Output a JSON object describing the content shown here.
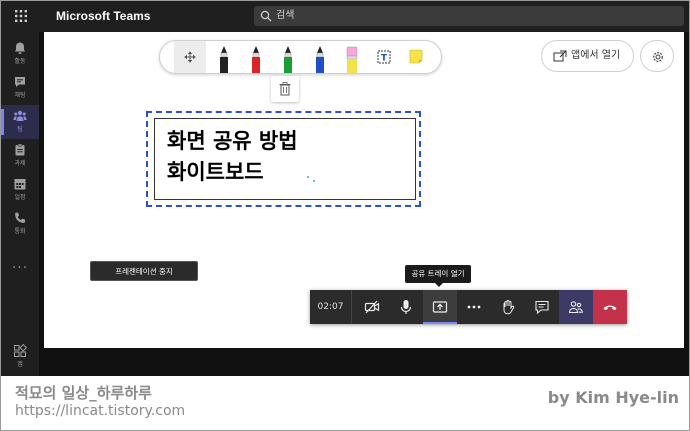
{
  "app": {
    "title": "Microsoft Teams"
  },
  "search": {
    "placeholder": "검색"
  },
  "rail": {
    "items": [
      {
        "label": "활동",
        "icon": "bell-icon"
      },
      {
        "label": "채팅",
        "icon": "chat-icon"
      },
      {
        "label": "팀",
        "icon": "teams-icon",
        "active": true
      },
      {
        "label": "과제",
        "icon": "assignments-icon"
      },
      {
        "label": "일정",
        "icon": "calendar-icon"
      },
      {
        "label": "통화",
        "icon": "phone-icon"
      }
    ],
    "more": "···",
    "apps_label": "앱"
  },
  "whiteboard": {
    "tools": [
      "move-icon",
      "black-pen-icon",
      "red-pen-icon",
      "green-pen-icon",
      "blue-pen-icon",
      "highlighter-icon",
      "text-icon",
      "sticky-note-icon"
    ],
    "open_in_app": "앱에서 열기",
    "text_lines": [
      "화면 공유 방법",
      "화이트보드"
    ]
  },
  "presentation": {
    "stop_label": "프레젠테이션 중지"
  },
  "share_tooltip": "공유 트레이 열기",
  "call": {
    "timer": "02:07",
    "controls": [
      "camera-off-icon",
      "mic-icon",
      "share-icon",
      "more-icon",
      "raise-hand-icon",
      "chat-icon",
      "people-icon",
      "hang-up-icon"
    ],
    "colors": {
      "hangup": "#c4314b",
      "accent": "#7f85f5"
    }
  },
  "watermark": {
    "blog_name": "적묘의 일상_하루하루",
    "url": "https://lincat.tistory.com",
    "author": "by Kim Hye-lin"
  }
}
